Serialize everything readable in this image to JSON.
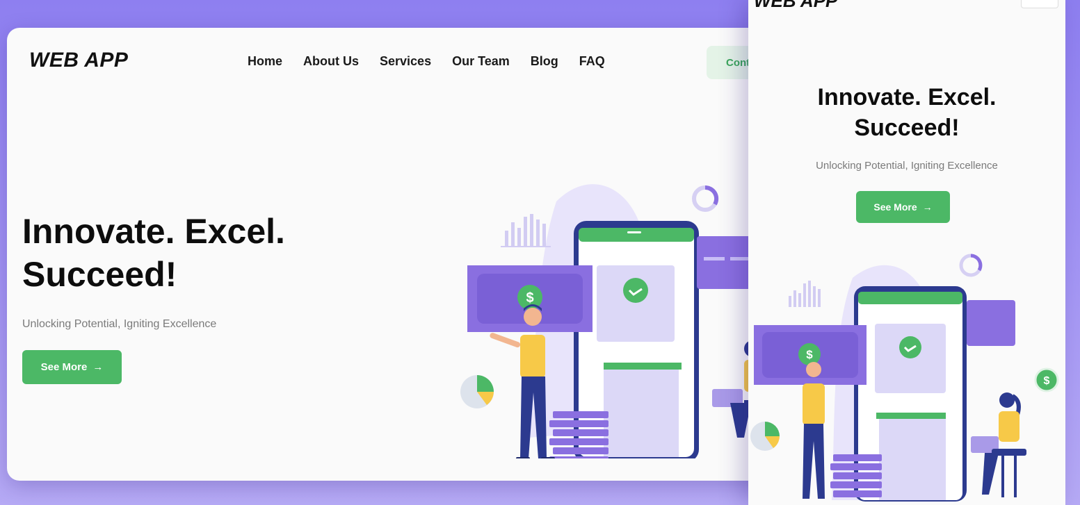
{
  "desktop": {
    "logo": "WEB APP",
    "nav": [
      "Home",
      "About Us",
      "Services",
      "Our Team",
      "Blog",
      "FAQ"
    ],
    "contact_label": "Cont",
    "hero": {
      "title_line1": "Innovate. Excel.",
      "title_line2": "Succeed!",
      "subtitle": "Unlocking Potential, Igniting Excellence",
      "button_label": "See More",
      "button_icon": "arrow-right-icon"
    }
  },
  "mobile": {
    "logo": "WEB APP",
    "hero": {
      "title_line1": "Innovate. Excel.",
      "title_line2": "Succeed!",
      "subtitle": "Unlocking Potential, Igniting Excellence",
      "button_label": "See More",
      "button_icon": "arrow-right-icon"
    },
    "menu_icon": "hamburger-menu-icon"
  },
  "illustration": {
    "currency_symbol": "$",
    "icons": [
      "dollar-coin-icon",
      "checkmark-icon",
      "pie-chart-icon",
      "bar-chart-icon",
      "donut-ring-icon"
    ]
  },
  "colors": {
    "accent_green": "#4cb866",
    "purple": "#8a6fe0",
    "navy": "#2c3a8f",
    "yellow": "#f7c948",
    "background_gradient_top": "#8e7ff0"
  }
}
